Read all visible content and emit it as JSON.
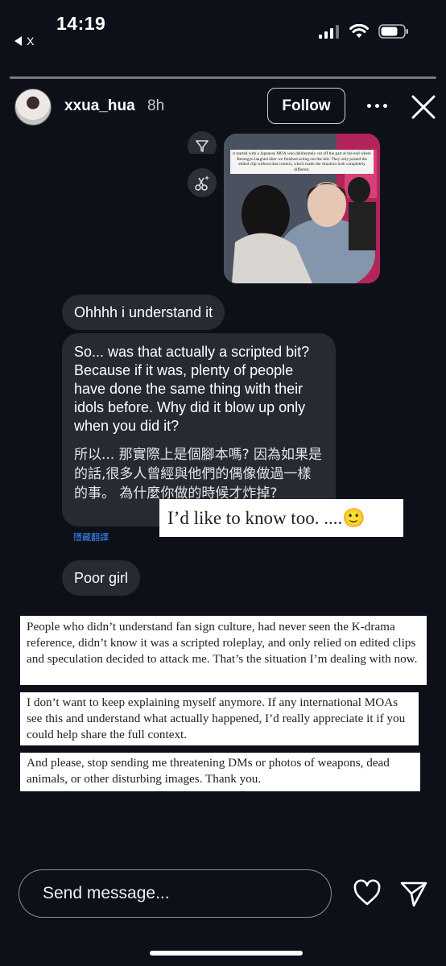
{
  "status": {
    "time": "14:19",
    "back_label": "X"
  },
  "story": {
    "username": "xxua_hua",
    "time_ago": "8h",
    "follow_label": "Follow"
  },
  "photo": {
    "caption": "it started with a Japanese MOA who deliberately cut off the part at the end where Beomgyu laughed after we finished acting out the skit. They only posted the edited clip without that context, which made the situation look completely different."
  },
  "messages": [
    {
      "text": "Ohhhh i understand it"
    },
    {
      "text": "So... was that actually a scripted bit? Because if it was, plenty of people have done the same thing with their idols before. Why did it blow up only when you did it?",
      "translation": "所以... 那實際上是個腳本嗎? 因為如果是的話,很多人曾經與他們的偶像做過一樣的事。 為什麼你做的時候才炸掉?"
    },
    {
      "text": "Poor girl"
    }
  ],
  "translate_link": "隱藏翻譯",
  "overlays": {
    "like_too": "I’d like to know too. ....🙂",
    "paragraph1": "People who didn’t understand fan sign culture, had never seen the K-drama reference, didn’t know it was a scripted roleplay, and only relied on edited clips and speculation decided to attack me. That’s the situation I’m dealing with now.",
    "paragraph2": "I don’t want to keep explaining myself anymore. If any international MOAs see this and understand what actually happened, I’d really appreciate it if you could help share the full context.",
    "paragraph3": "And please, stop sending me threatening DMs or photos of weapons, dead animals, or other disturbing images. Thank you."
  },
  "footer": {
    "message_placeholder": "Send message..."
  },
  "icons": [
    "signal-icon",
    "wifi-icon",
    "battery-icon",
    "more-icon",
    "close-icon",
    "funnel-icon",
    "scissors-sparkle-icon",
    "heart-icon",
    "send-icon"
  ]
}
